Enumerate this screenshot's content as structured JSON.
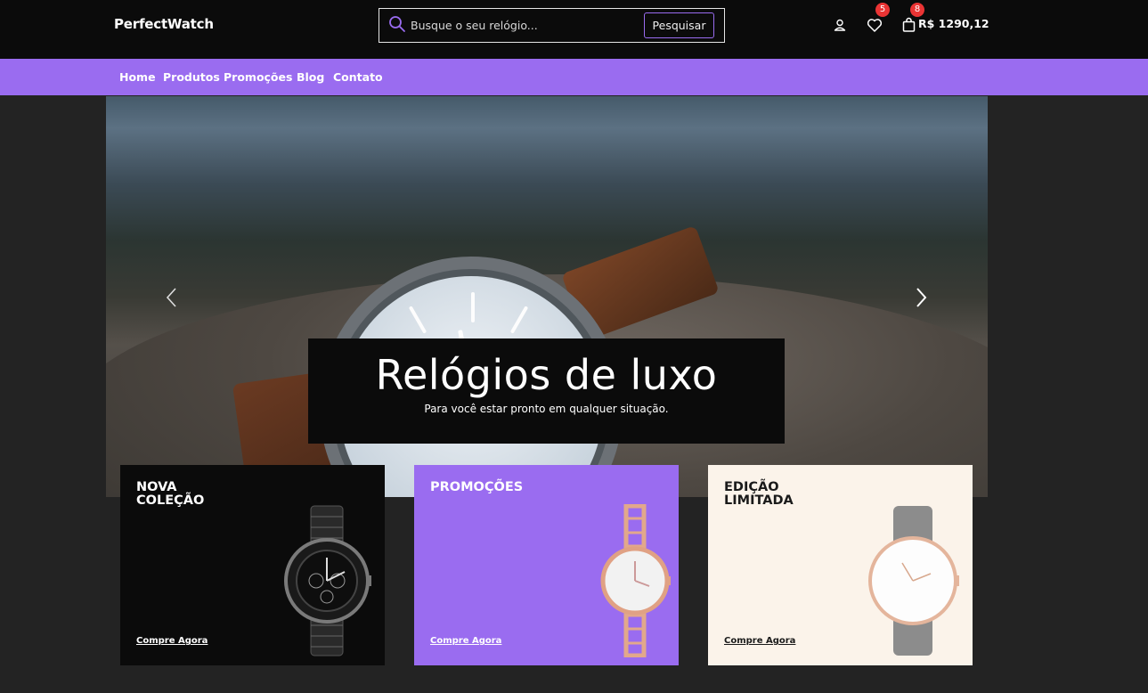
{
  "header": {
    "logo": "PerfectWatch",
    "search": {
      "placeholder": "Busque o seu relógio...",
      "button_label": "Pesquisar"
    },
    "wishlist_count": "5",
    "cart_count": "8",
    "cart_total": "R$ 1290,12",
    "icons": [
      "search-icon",
      "user-icon",
      "heart-icon",
      "bag-icon"
    ]
  },
  "nav": {
    "items": [
      "Home",
      "Produtos",
      "Promoções",
      "Blog",
      "Contato"
    ]
  },
  "hero": {
    "title": "Relógios de luxo",
    "subtitle": "Para você estar pronto em qualquer situação."
  },
  "cards": [
    {
      "title": "Nova Coleção",
      "link": "Compre Agora",
      "background": "#0b0b0b"
    },
    {
      "title": "Promoções",
      "link": "Compre Agora",
      "background": "#9a6cf0"
    },
    {
      "title": "Edição Limitada",
      "link": "Compre Agora",
      "background": "#fbf3ea"
    }
  ],
  "colors": {
    "accent": "#9a6cf0",
    "header_bg": "#0b0b0b",
    "page_bg": "#232323",
    "badge": "#ea3434"
  }
}
